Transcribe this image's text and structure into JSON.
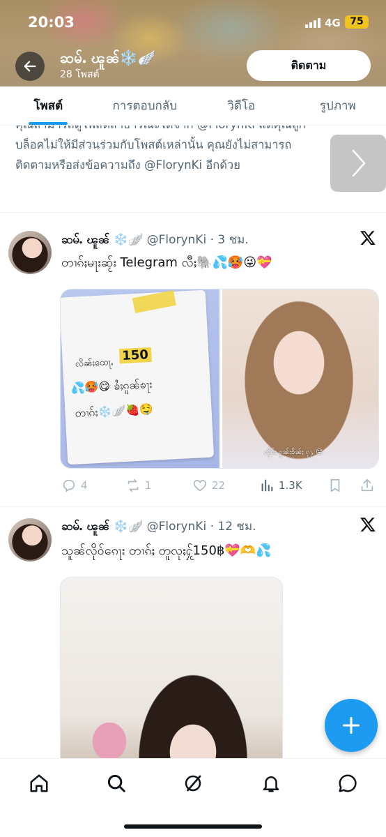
{
  "status_bar": {
    "time": "20:03",
    "network": "4G",
    "battery": "75"
  },
  "header": {
    "name": "ဆမ်ႉ ၽူၼ်❄️🪽",
    "posts_count": "28 โพสต์",
    "follow_label": "ติดตาม"
  },
  "tabs": [
    {
      "label": "โพสต์",
      "active": true
    },
    {
      "label": "การตอบกลับ",
      "active": false
    },
    {
      "label": "วิดีโอ",
      "active": false
    },
    {
      "label": "รูปภาพ",
      "active": false
    }
  ],
  "notice": {
    "line1": "คุณสามารถดูโพสต์สาธารณะได้จาก @FlorynKi แต่คุณถูก",
    "line2": "บล็อคไม่ให้มีส่วนร่วมกับโพสต์เหล่านั้น คุณยังไม่สามารถ",
    "line3": "ติดตามหรือส่งข้อความถึง @FlorynKi อีกด้วย"
  },
  "tweets": [
    {
      "name": "ဆမ်ႉ ၽူၼ်",
      "emoji": "❄️🪽",
      "handle": "@FlorynKi",
      "time": " · 3 ชม.",
      "text": "တၢၵ်ႈမႃးဆႂ်း Telegram လီႈ🐘💦🥵😜💝",
      "note": {
        "line1": "လိၼ်ႈထေႃႇ",
        "price": "150",
        "line2": "💦🥵😋 ၶႆႈၵူၼ်ၶႃး",
        "line3": "တၢၵ်ႈ❄️🪽🍓🤤"
      },
      "right_caption": "ၸိုဝ်ႈ ၵူၼ်းၶိုၼ်ႈ ၵႂႃႇ 😝",
      "replies": "4",
      "reposts": "1",
      "likes": "22",
      "views": "1.3K"
    },
    {
      "name": "ဆမ်ႉ ၽူၼ်",
      "emoji": "❄️🪽",
      "handle": "@FlorynKi",
      "time": " · 12 ชม.",
      "text": "သူၼ်လိုဝ်ၵေႃး တၢၵ်ႈ တူလုႈႁႂ်150฿💝🫶💦"
    }
  ],
  "icons": {
    "back": "back-arrow-icon",
    "x": "x-logo-icon",
    "reply": "reply-icon",
    "repost": "repost-icon",
    "like": "heart-icon",
    "views": "views-icon",
    "bookmark": "bookmark-icon",
    "share": "share-icon",
    "compose": "plus-icon",
    "nav": [
      "home-icon",
      "search-icon",
      "grok-icon",
      "notifications-icon",
      "messages-icon"
    ]
  },
  "colors": {
    "accent": "#1d9bf0",
    "text": "#0f1419",
    "muted": "#536471"
  }
}
